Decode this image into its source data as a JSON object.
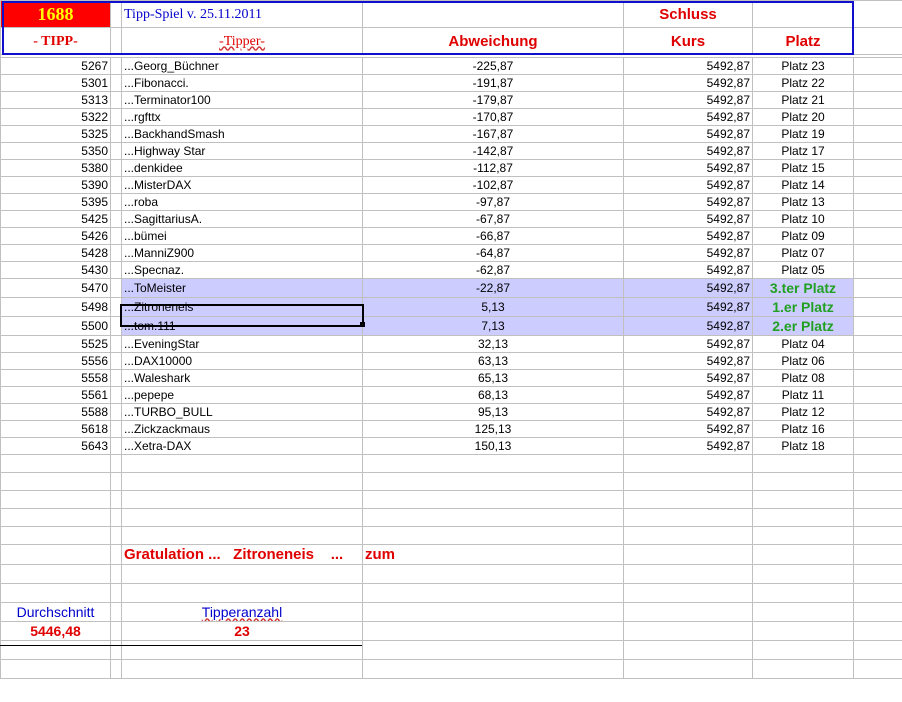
{
  "header": {
    "count": "1688",
    "title": "Tipp-Spiel v. 25.11.2011",
    "schluss": "Schluss",
    "col_tipp": "- TIPP-",
    "col_tipper": "-Tipper-",
    "col_abw": "Abweichung",
    "col_kurs": "Kurs",
    "col_platz": "Platz"
  },
  "colors": {
    "header_red": "#e00000",
    "highlight": "#ccccff",
    "winner_green": "#22a022"
  },
  "rows": [
    {
      "tipp": "5267",
      "name": "...Georg_Büchner",
      "abw": "-225,87",
      "kurs": "5492,87",
      "platz": "Platz 23"
    },
    {
      "tipp": "5301",
      "name": "...Fibonacci.",
      "abw": "-191,87",
      "kurs": "5492,87",
      "platz": "Platz 22"
    },
    {
      "tipp": "5313",
      "name": "...Terminator100",
      "abw": "-179,87",
      "kurs": "5492,87",
      "platz": "Platz 21"
    },
    {
      "tipp": "5322",
      "name": "...rgfttx",
      "abw": "-170,87",
      "kurs": "5492,87",
      "platz": "Platz 20"
    },
    {
      "tipp": "5325",
      "name": "...BackhandSmash",
      "abw": "-167,87",
      "kurs": "5492,87",
      "platz": "Platz 19"
    },
    {
      "tipp": "5350",
      "name": "...Highway Star",
      "abw": "-142,87",
      "kurs": "5492,87",
      "platz": "Platz 17"
    },
    {
      "tipp": "5380",
      "name": "...denkidee",
      "abw": "-112,87",
      "kurs": "5492,87",
      "platz": "Platz 15"
    },
    {
      "tipp": "5390",
      "name": "...MisterDAX",
      "abw": "-102,87",
      "kurs": "5492,87",
      "platz": "Platz 14"
    },
    {
      "tipp": "5395",
      "name": "...roba",
      "abw": "-97,87",
      "kurs": "5492,87",
      "platz": "Platz 13"
    },
    {
      "tipp": "5425",
      "name": "...SagittariusA.",
      "abw": "-67,87",
      "kurs": "5492,87",
      "platz": "Platz 10"
    },
    {
      "tipp": "5426",
      "name": "...bümei",
      "abw": "-66,87",
      "kurs": "5492,87",
      "platz": "Platz 09"
    },
    {
      "tipp": "5428",
      "name": "...ManniZ900",
      "abw": "-64,87",
      "kurs": "5492,87",
      "platz": "Platz 07"
    },
    {
      "tipp": "5430",
      "name": "...Specnaz.",
      "abw": "-62,87",
      "kurs": "5492,87",
      "platz": "Platz 05"
    },
    {
      "tipp": "5470",
      "name": "...ToMeister",
      "abw": "-22,87",
      "kurs": "5492,87",
      "platz": "3.ter Platz",
      "winner": true
    },
    {
      "tipp": "5498",
      "name": "...Zitroneneis",
      "abw": "5,13",
      "kurs": "5492,87",
      "platz": "1.er Platz",
      "winner": true
    },
    {
      "tipp": "5500",
      "name": "...tom.111",
      "abw": "7,13",
      "kurs": "5492,87",
      "platz": "2.er Platz",
      "winner": true
    },
    {
      "tipp": "5525",
      "name": "...EveningStar",
      "abw": "32,13",
      "kurs": "5492,87",
      "platz": "Platz 04"
    },
    {
      "tipp": "5556",
      "name": "...DAX10000",
      "abw": "63,13",
      "kurs": "5492,87",
      "platz": "Platz 06"
    },
    {
      "tipp": "5558",
      "name": "...Waleshark",
      "abw": "65,13",
      "kurs": "5492,87",
      "platz": "Platz 08"
    },
    {
      "tipp": "5561",
      "name": "...pepepe",
      "abw": "68,13",
      "kurs": "5492,87",
      "platz": "Platz 11"
    },
    {
      "tipp": "5588",
      "name": "...TURBO_BULL",
      "abw": "95,13",
      "kurs": "5492,87",
      "platz": "Platz 12"
    },
    {
      "tipp": "5618",
      "name": "...Zickzackmaus",
      "abw": "125,13",
      "kurs": "5492,87",
      "platz": "Platz 16"
    },
    {
      "tipp": "5643",
      "name": "...Xetra-DAX",
      "abw": "150,13",
      "kurs": "5492,87",
      "platz": "Platz 18"
    }
  ],
  "footer": {
    "gratulation": "Gratulation ...   Zitroneneis    ...",
    "zum": "zum",
    "avg_label": "Durchschnitt",
    "avg_value": "5446,48",
    "count_label": "Tipperanzahl",
    "count_value": "23"
  }
}
